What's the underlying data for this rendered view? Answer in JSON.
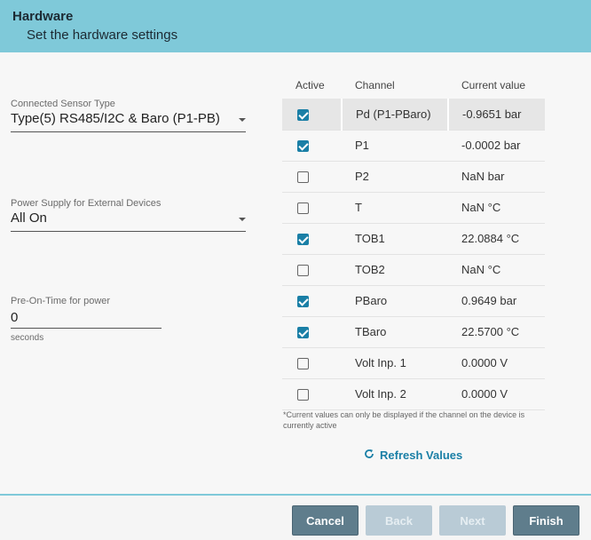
{
  "header": {
    "title": "Hardware",
    "subtitle": "Set the hardware settings"
  },
  "fields": {
    "sensor_type": {
      "label": "Connected Sensor Type",
      "value": "Type(5) RS485/I2C & Baro (P1-PB)"
    },
    "power_supply": {
      "label": "Power Supply for External Devices",
      "value": "All On"
    },
    "pre_on_time": {
      "label": "Pre-On-Time for power",
      "value": "0",
      "unit": "seconds"
    }
  },
  "table": {
    "columns": [
      "Active",
      "Channel",
      "Current value"
    ],
    "rows": [
      {
        "active": true,
        "channel": "Pd (P1-PBaro)",
        "value": "-0.9651  bar",
        "selected": true
      },
      {
        "active": true,
        "channel": "P1",
        "value": "-0.0002  bar"
      },
      {
        "active": false,
        "channel": "P2",
        "value": "NaN  bar"
      },
      {
        "active": false,
        "channel": "T",
        "value": "NaN  °C"
      },
      {
        "active": true,
        "channel": "TOB1",
        "value": "22.0884  °C"
      },
      {
        "active": false,
        "channel": "TOB2",
        "value": "NaN  °C"
      },
      {
        "active": true,
        "channel": "PBaro",
        "value": "0.9649  bar"
      },
      {
        "active": true,
        "channel": "TBaro",
        "value": "22.5700  °C"
      },
      {
        "active": false,
        "channel": "Volt Inp. 1",
        "value": "0.0000  V"
      },
      {
        "active": false,
        "channel": "Volt Inp. 2",
        "value": "0.0000  V"
      }
    ],
    "note": "*Current values can only be displayed if the channel on the device is currently active"
  },
  "refresh_label": "Refresh Values",
  "buttons": {
    "cancel": "Cancel",
    "back": "Back",
    "next": "Next",
    "finish": "Finish"
  },
  "colors": {
    "header_bg": "#7fc9d9",
    "accent": "#1a7fa6",
    "button_dark": "#5f7d8c",
    "button_disabled": "#b9cbd6"
  }
}
